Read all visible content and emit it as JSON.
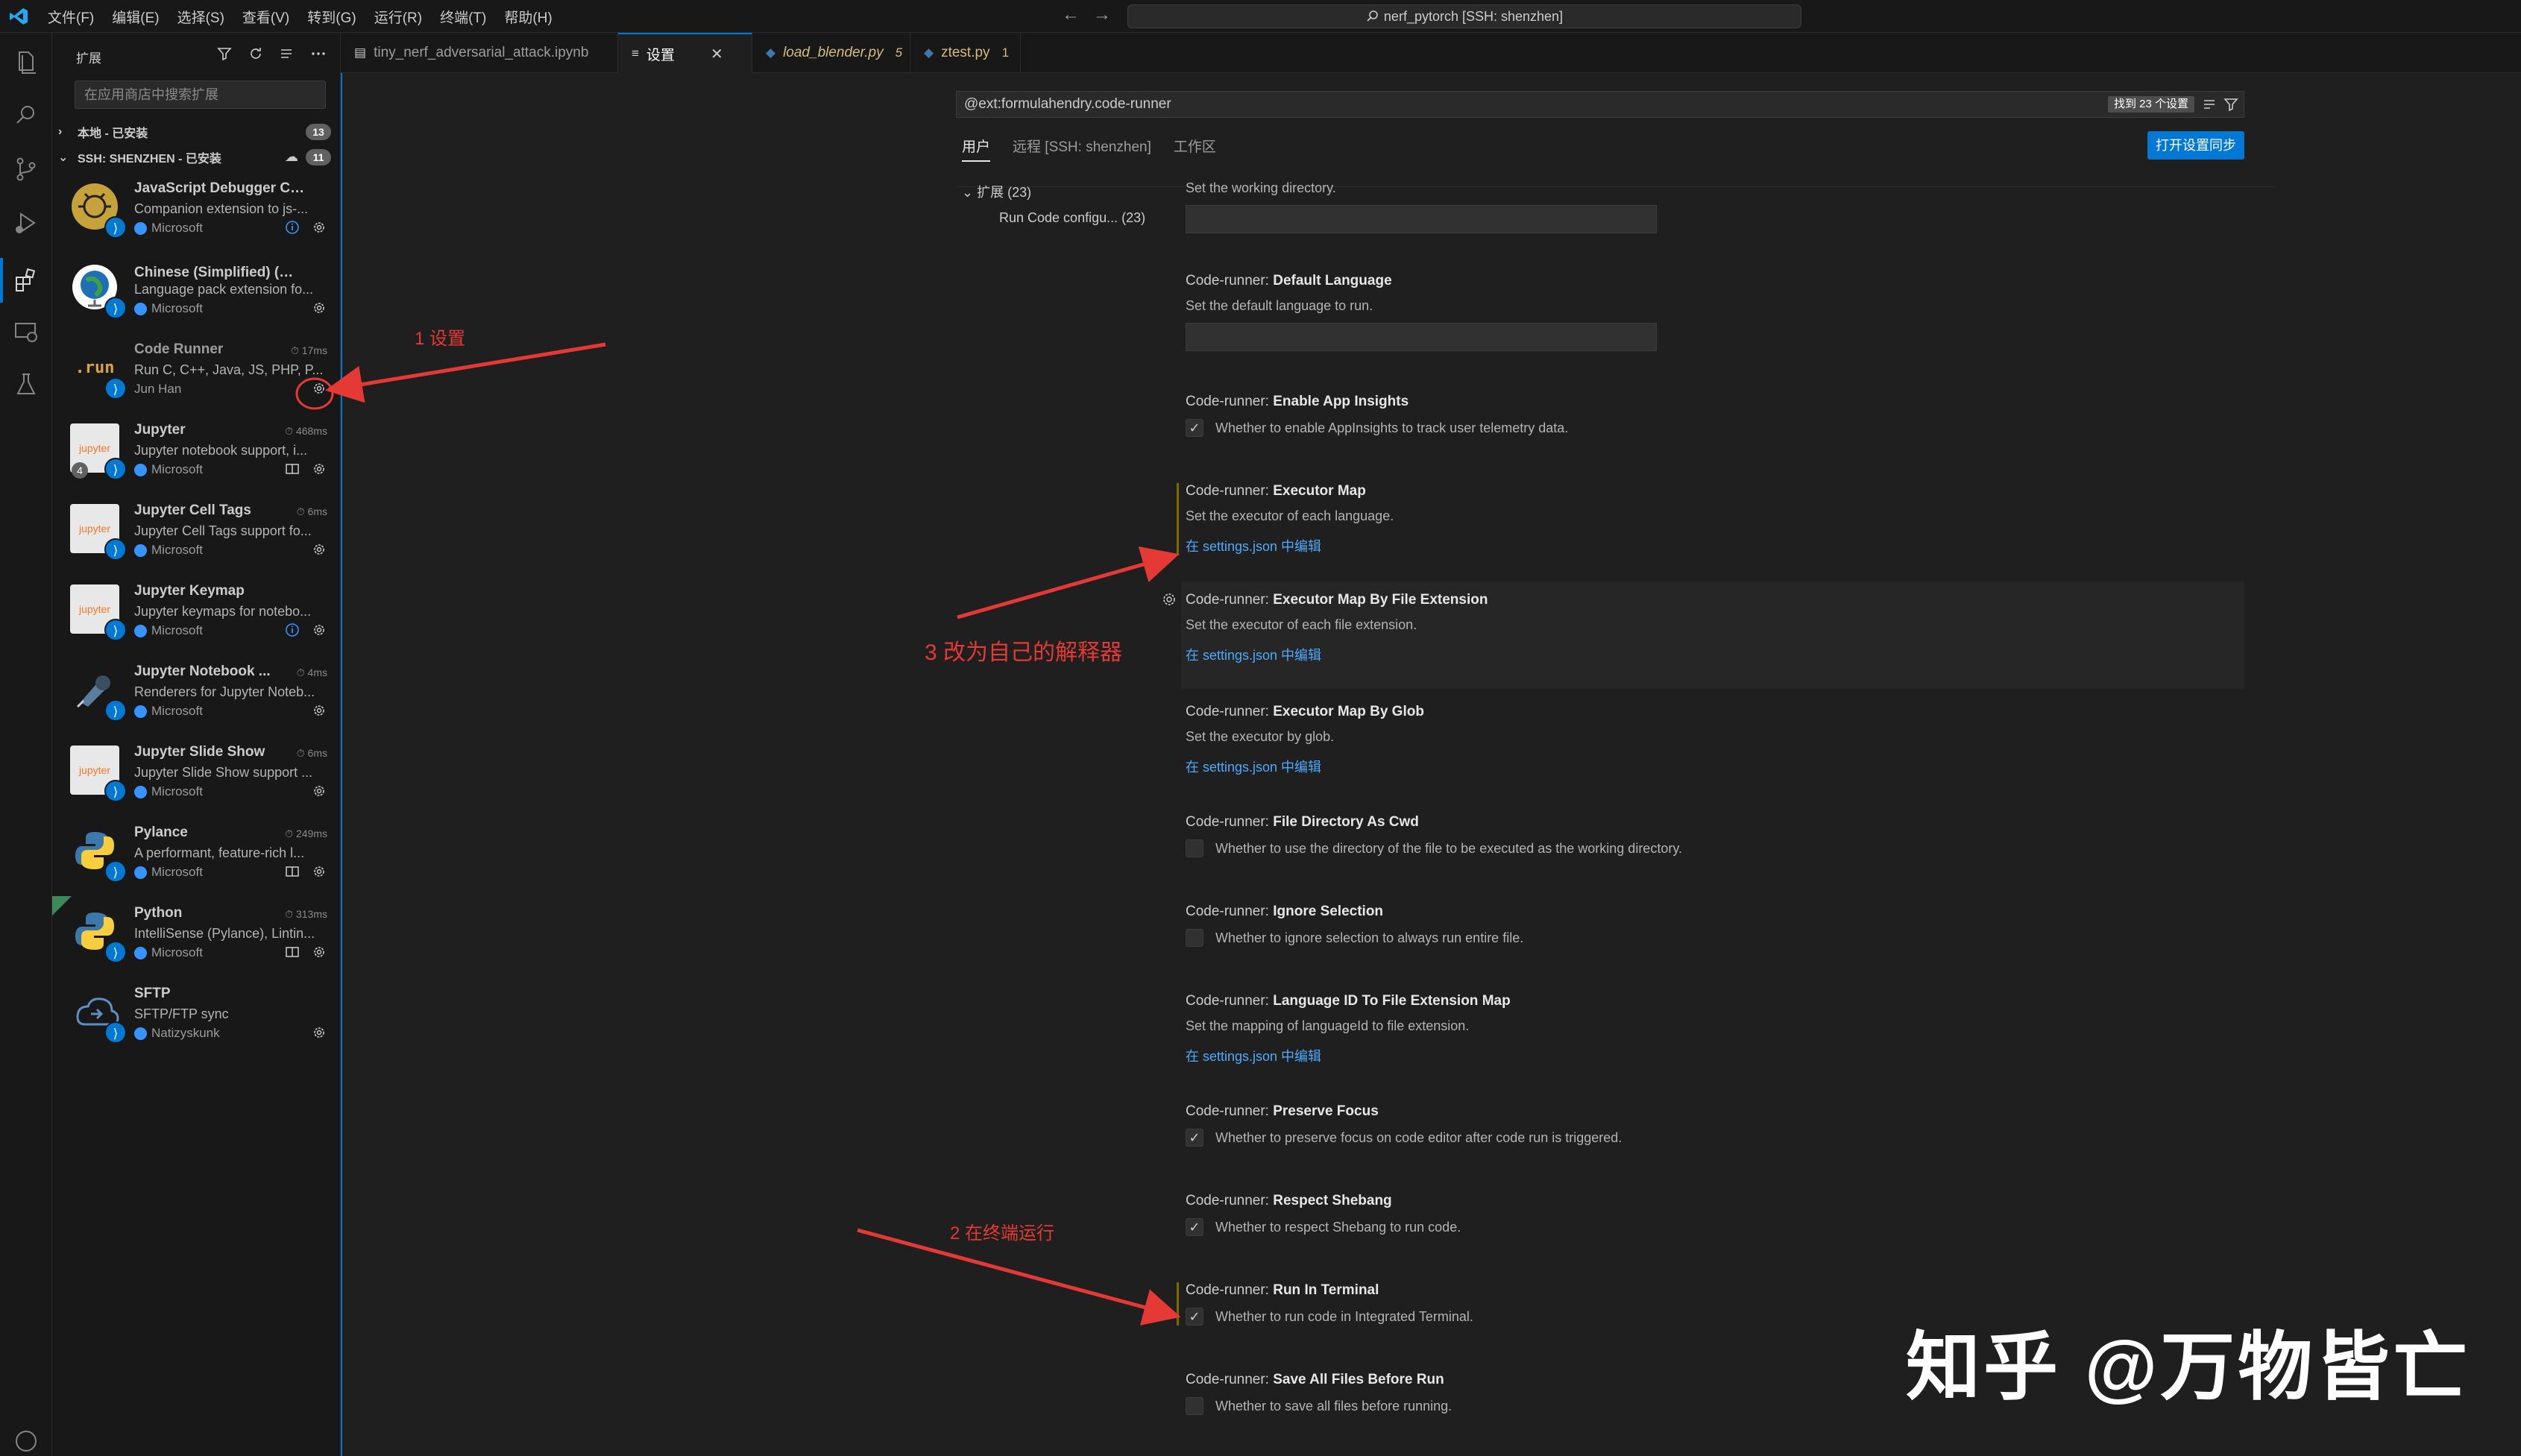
{
  "titlebar": {
    "menu": [
      "文件(F)",
      "编辑(E)",
      "选择(S)",
      "查看(V)",
      "转到(G)",
      "运行(R)",
      "终端(T)",
      "帮助(H)"
    ],
    "command_center": "nerf_pytorch [SSH: shenzhen]"
  },
  "sidebar": {
    "title": "扩展",
    "search_placeholder": "在应用商店中搜索扩展",
    "groups": [
      {
        "label": "本地 - 已安装",
        "count": "13"
      },
      {
        "label": "SSH: SHENZHEN - 已安装",
        "count": "11"
      }
    ],
    "extensions": [
      {
        "name": "JavaScript Debugger Com...",
        "desc": "Companion extension to js-...",
        "publisher": "Microsoft",
        "time": ""
      },
      {
        "name": "Chinese (Simplified) (简体...",
        "desc": "Language pack extension fo...",
        "publisher": "Microsoft",
        "time": ""
      },
      {
        "name": "Code Runner",
        "desc": "Run C, C++, Java, JS, PHP, P...",
        "publisher": "Jun Han",
        "time": "17ms"
      },
      {
        "name": "Jupyter",
        "desc": "Jupyter notebook support, i...",
        "publisher": "Microsoft",
        "time": "468ms"
      },
      {
        "name": "Jupyter Cell Tags",
        "desc": "Jupyter Cell Tags support fo...",
        "publisher": "Microsoft",
        "time": "6ms"
      },
      {
        "name": "Jupyter Keymap",
        "desc": "Jupyter keymaps for notebo...",
        "publisher": "Microsoft",
        "time": ""
      },
      {
        "name": "Jupyter Notebook ...",
        "desc": "Renderers for Jupyter Noteb...",
        "publisher": "Microsoft",
        "time": "4ms"
      },
      {
        "name": "Jupyter Slide Show",
        "desc": "Jupyter Slide Show support ...",
        "publisher": "Microsoft",
        "time": "6ms"
      },
      {
        "name": "Pylance",
        "desc": "A performant, feature-rich l...",
        "publisher": "Microsoft",
        "time": "249ms"
      },
      {
        "name": "Python",
        "desc": "IntelliSense (Pylance), Lintin...",
        "publisher": "Microsoft",
        "time": "313ms"
      },
      {
        "name": "SFTP",
        "desc": "SFTP/FTP sync",
        "publisher": "Natizyskunk",
        "time": ""
      }
    ],
    "icon_labels": {
      "run": ".run",
      "jupyter": "jupyter",
      "badge_number": "4"
    }
  },
  "tabs": [
    {
      "label": "tiny_nerf_adversarial_attack.ipynb",
      "badge": ""
    },
    {
      "label": "设置",
      "badge": ""
    },
    {
      "label": "load_blender.py",
      "badge": "5"
    },
    {
      "label": "ztest.py",
      "badge": "1"
    }
  ],
  "settings": {
    "search_value": "@ext:formulahendry.code-runner",
    "found": "找到 23 个设置",
    "scopes": [
      "用户",
      "远程 [SSH: shenzhen]",
      "工作区"
    ],
    "sync_button": "打开设置同步",
    "toc_header": "扩展 (23)",
    "toc_item": "Run Code configu... (23)",
    "items": [
      {
        "prefix": "",
        "title": "",
        "desc": "Set the working directory.",
        "kind": "input"
      },
      {
        "prefix": "Code-runner: ",
        "title": "Default Language",
        "desc": "Set the default language to run.",
        "kind": "input"
      },
      {
        "prefix": "Code-runner: ",
        "title": "Enable App Insights",
        "desc": "Whether to enable AppInsights to track user telemetry data.",
        "kind": "checkbox",
        "checked": true
      },
      {
        "prefix": "Code-runner: ",
        "title": "Executor Map",
        "desc": "Set the executor of each language.",
        "kind": "link",
        "link": "在 settings.json 中编辑"
      },
      {
        "prefix": "Code-runner: ",
        "title": "Executor Map By File Extension",
        "desc": "Set the executor of each file extension.",
        "kind": "link",
        "link": "在 settings.json 中编辑"
      },
      {
        "prefix": "Code-runner: ",
        "title": "Executor Map By Glob",
        "desc": "Set the executor by glob.",
        "kind": "link",
        "link": "在 settings.json 中编辑"
      },
      {
        "prefix": "Code-runner: ",
        "title": "File Directory As Cwd",
        "desc": "Whether to use the directory of the file to be executed as the working directory.",
        "kind": "checkbox",
        "checked": false
      },
      {
        "prefix": "Code-runner: ",
        "title": "Ignore Selection",
        "desc": "Whether to ignore selection to always run entire file.",
        "kind": "checkbox",
        "checked": false
      },
      {
        "prefix": "Code-runner: ",
        "title": "Language ID To File Extension Map",
        "desc": "Set the mapping of languageId to file extension.",
        "kind": "link",
        "link": "在 settings.json 中编辑"
      },
      {
        "prefix": "Code-runner: ",
        "title": "Preserve Focus",
        "desc": "Whether to preserve focus on code editor after code run is triggered.",
        "kind": "checkbox",
        "checked": true
      },
      {
        "prefix": "Code-runner: ",
        "title": "Respect Shebang",
        "desc": "Whether to respect Shebang to run code.",
        "kind": "checkbox",
        "checked": true
      },
      {
        "prefix": "Code-runner: ",
        "title": "Run In Terminal",
        "desc": "Whether to run code in Integrated Terminal.",
        "kind": "checkbox",
        "checked": true
      },
      {
        "prefix": "Code-runner: ",
        "title": "Save All Files Before Run",
        "desc": "Whether to save all files before running.",
        "kind": "checkbox",
        "checked": false
      }
    ]
  },
  "annotations": {
    "a1": "1 设置",
    "a2": "2 在终端运行",
    "a3": "3 改为自己的解释器",
    "color": "#e53935"
  },
  "watermark": "知乎 @万物皆亡",
  "colors": {
    "accent": "#0078d4",
    "link": "#4daafc",
    "bg": "#1f1f1f",
    "sidebar": "#181818"
  }
}
